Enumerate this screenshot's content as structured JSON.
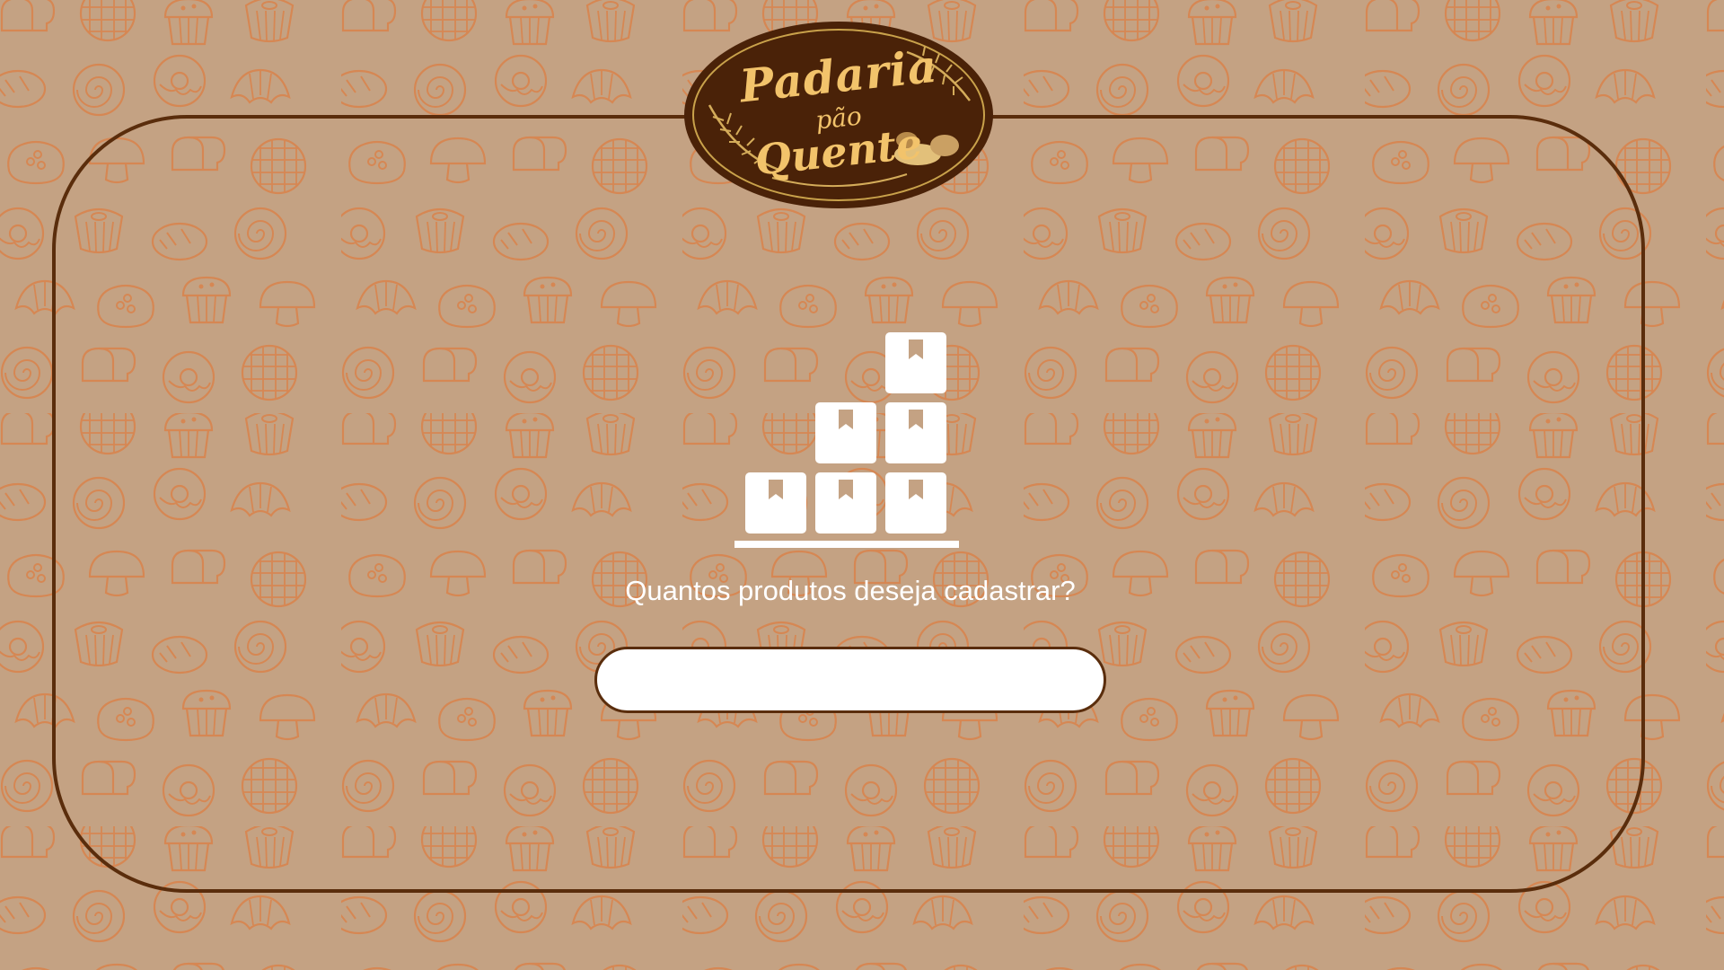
{
  "app": {
    "logo": {
      "line1": "Padaria",
      "line2": "pão",
      "line3": "Quente"
    }
  },
  "main": {
    "icon": "stacked-boxes-icon",
    "question": "Quantos produtos deseja cadastrar?",
    "input": {
      "value": "",
      "placeholder": ""
    }
  },
  "colors": {
    "background": "#c4a283",
    "pattern": "#d9824a",
    "frame": "#5a2d0c",
    "logo_fill": "#4a2208",
    "logo_text": "#f2c36b",
    "text": "#ffffff"
  }
}
